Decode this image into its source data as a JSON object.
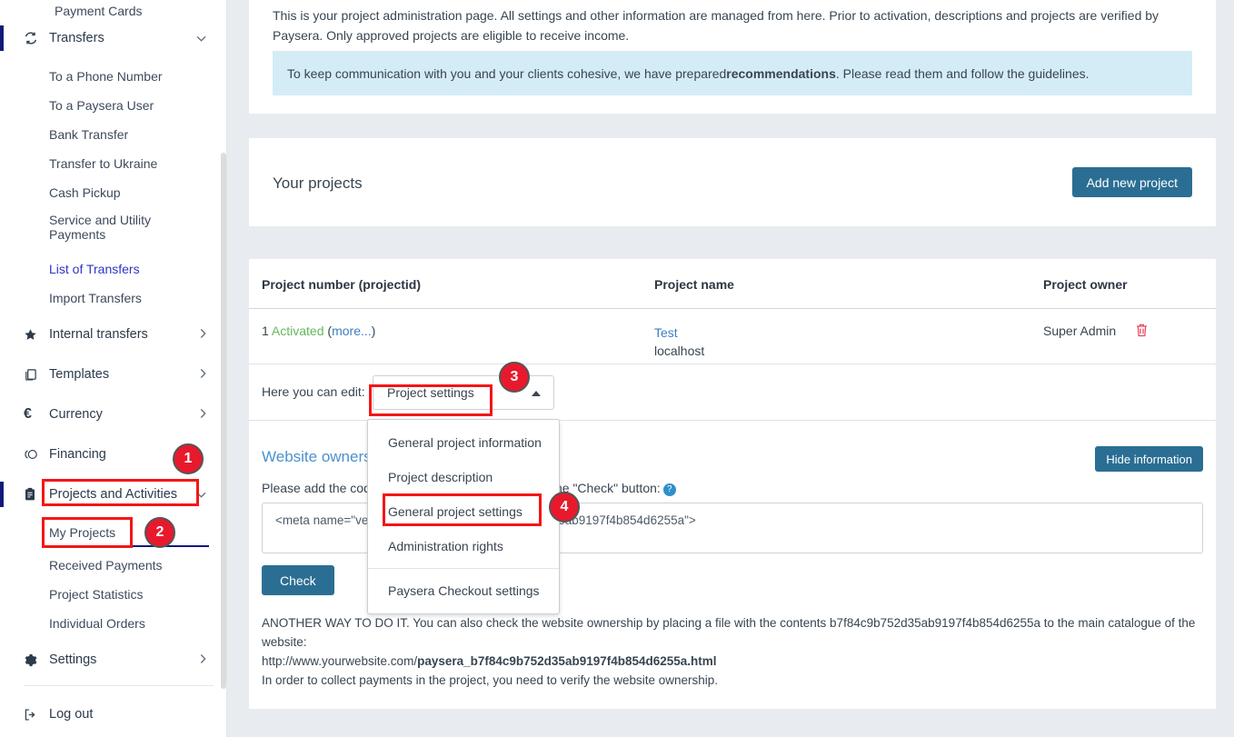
{
  "sidebar": {
    "top_partial_item": "Payment Cards",
    "groups": [
      {
        "label": "Transfers",
        "icon": "transfers-icon",
        "chevron": "chevron-down",
        "active": true,
        "children": [
          "To a Phone Number",
          "To a Paysera User",
          "Bank Transfer",
          "Transfer to Ukraine",
          "Cash Pickup",
          "Service and Utility Payments",
          "List of Transfers",
          "Import Transfers"
        ],
        "active_child": "List of Transfers"
      },
      {
        "label": "Internal transfers",
        "icon": "star-icon",
        "chevron": "chevron-right"
      },
      {
        "label": "Templates",
        "icon": "templates-icon",
        "chevron": "chevron-right"
      },
      {
        "label": "Currency",
        "icon": "euro-icon",
        "chevron": "chevron-right"
      },
      {
        "label": "Financing",
        "icon": "financing-icon",
        "chevron": ""
      },
      {
        "label": "Projects and Activities",
        "icon": "clipboard-icon",
        "chevron": "chevron-down",
        "active": true,
        "children": [
          "My Projects",
          "Received Payments",
          "Project Statistics",
          "Individual Orders"
        ],
        "active_child": "My Projects"
      },
      {
        "label": "Settings",
        "icon": "gear-icon",
        "chevron": "chevron-right"
      }
    ],
    "logout": {
      "label": "Log out",
      "icon": "logout-icon"
    }
  },
  "intro": {
    "paragraph": "This is your project administration page. All settings and other information are managed from here. Prior to activation, descriptions and projects are verified by Paysera. Only approved projects are eligible to receive income.",
    "notice_before": "To keep communication with you and your clients cohesive, we have prepared ",
    "notice_bold": "recommendations",
    "notice_after": " . Please read them and follow the guidelines."
  },
  "projects_panel": {
    "title": "Your projects",
    "add_button": "Add new project"
  },
  "table": {
    "columns": [
      "Project number (projectid)",
      "Project name",
      "Project owner"
    ],
    "rows": [
      {
        "number": "1",
        "status": "Activated",
        "more_open": "(",
        "more": "more...",
        "more_close": ")",
        "name": "Test",
        "host": "localhost",
        "owner": "Super Admin",
        "delete_icon": "trash-icon"
      }
    ]
  },
  "edit_row": {
    "label": "Here you can edit:",
    "selected": "Project settings",
    "caret": "caret-up-icon",
    "options": [
      "General project information",
      "Project description",
      "General project settings",
      "Administration rights",
      "Paysera Checkout settings"
    ]
  },
  "ownership": {
    "title": "Website ownership",
    "hide_button": "Hide information",
    "instruction": "Please add the code to the website area and press the \"Check\" button:",
    "help_icon": "help-icon",
    "code_value": "<meta name=\"verification\" content=\"b7f84c9b752d35ab9197f4b854d6255a\">",
    "check_button": "Check",
    "another_way_line1": "ANOTHER WAY TO DO IT. You can also check the website ownership by placing a file with the contents b7f84c9b752d35ab9197f4b854d6255a to the main catalogue of the website:",
    "url_prefix": "http://www.yourwebsite.com/",
    "url_bold": "paysera_b7f84c9b752d35ab9197f4b854d6255a.html",
    "final_line": "In order to collect payments in the project, you need to verify the website ownership."
  },
  "annotations": {
    "badges": [
      "1",
      "2",
      "3",
      "4"
    ]
  },
  "colors": {
    "accent": "#2b6e93",
    "link": "#3a7fc1",
    "annotation": "#e8192c",
    "notice_bg": "#d4ecf6",
    "page_bg": "#e8ecf0"
  }
}
